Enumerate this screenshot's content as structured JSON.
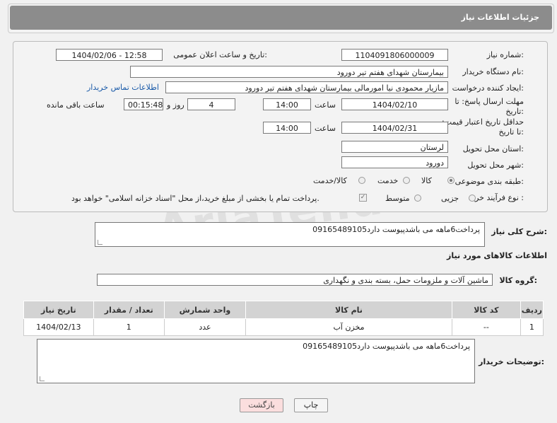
{
  "header": {
    "title": "جزئیات اطلاعات نیاز"
  },
  "form": {
    "need_number_label": "شماره نیاز:",
    "need_number": "1104091806000009",
    "announce_label": "تاریخ و ساعت اعلان عمومی:",
    "announce_value": "1404/02/06 - 12:58",
    "buyer_org_label": "نام دستگاه خریدار:",
    "buyer_org": "بیمارستان شهدای هفتم تیر دورود",
    "creator_label": "ایجاد کننده درخواست:",
    "creator": "مازیار محمودی نیا امورمالی بیمارستان شهدای هفتم تیر دورود",
    "contact_link": "اطلاعات تماس خریدار",
    "reply_deadline_label": "مهلت ارسال پاسخ: تا تاریخ:",
    "reply_date": "1404/02/10",
    "time_label": "ساعت",
    "reply_time": "14:00",
    "days_value": "4",
    "days_label": "روز و",
    "remaining_time": "00:15:48",
    "remaining_label": "ساعت باقی مانده",
    "price_deadline_label": "حداقل تاریخ اعتبار قیمت: تا تاریخ:",
    "price_date": "1404/02/31",
    "price_time": "14:00",
    "province_label": "استان محل تحویل:",
    "province": "لرستان",
    "city_label": "شهر محل تحویل:",
    "city": "دورود",
    "category_label": "طبقه بندی موضوعی:",
    "category_options": [
      "کالا",
      "خدمت",
      "کالا/خدمت"
    ],
    "category_selected": "کالا",
    "process_label": "نوع فرآیند خرید :",
    "process_options": [
      "جزیی",
      "متوسط"
    ],
    "process_note": "پرداخت تمام یا بخشی از مبلغ خرید،از محل \"اسناد خزانه اسلامی\" خواهد بود."
  },
  "description": {
    "label": "شرح کلی نیاز:",
    "value": "پرداخت6ماهه می باشدپیوست دارد09165489105"
  },
  "goods": {
    "section_title": "اطلاعات کالاهای مورد نیاز",
    "group_label": "گروه کالا:",
    "group_value": "ماشین آلات و ملزومات حمل، بسته بندی و نگهداری",
    "columns": [
      "ردیف",
      "کد کالا",
      "نام کالا",
      "واحد شمارش",
      "تعداد / مقدار",
      "تاریخ نیاز"
    ],
    "rows": [
      [
        "1",
        "--",
        "مخزن آب",
        "عدد",
        "1",
        "1404/02/13"
      ]
    ]
  },
  "buyer_notes": {
    "label": "توضیحات خریدار:",
    "value": "پرداخت6ماهه می باشدپیوست دارد09165489105"
  },
  "buttons": {
    "print": "چاپ",
    "back": "بازگشت"
  },
  "watermark": "AriaTender.neT"
}
